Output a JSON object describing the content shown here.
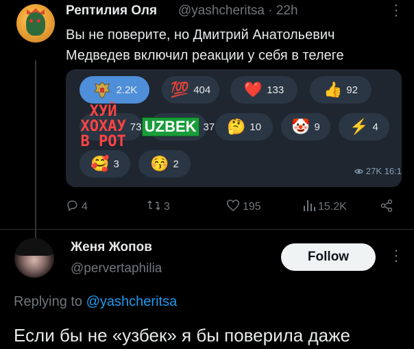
{
  "tweet": {
    "author_name": "Рептилия Оля",
    "handle": "@yashcheritsa",
    "separator": "·",
    "time": "22h",
    "text": "Вы не поверите, но Дмитрий Анатольевич Медведев включил реакции у себя в телеге",
    "more_icon": "more-vertical-icon"
  },
  "reactions_card": {
    "reactions": [
      {
        "icon": "coat-of-arms-emoji",
        "count": "2.2K",
        "active": true
      },
      {
        "icon": "hundred-emoji",
        "glyph": "💯",
        "count": "404"
      },
      {
        "icon": "heart-emoji",
        "glyph": "❤️",
        "count": "133"
      },
      {
        "icon": "thumbs-up-emoji",
        "glyph": "👍",
        "count": "92"
      },
      {
        "icon": "text-sticker-emoji",
        "sticker_text": "ХУЙ\nХОХАУ\nВ РОТ",
        "count": "73"
      },
      {
        "icon": "uzbek-sticker-emoji",
        "sticker_text": "UZBEK",
        "count": "37"
      },
      {
        "icon": "thinking-emoji",
        "glyph": "🤔",
        "count": "10"
      },
      {
        "icon": "clown-emoji",
        "glyph": "🤡",
        "count": "9"
      },
      {
        "icon": "lightning-emoji",
        "glyph": "⚡",
        "count": "4"
      },
      {
        "icon": "hearts-face-emoji",
        "glyph": "🥰",
        "count": "3"
      },
      {
        "icon": "kiss-face-emoji",
        "glyph": "😚",
        "count": "2"
      }
    ],
    "views": "27K",
    "time": "16:1"
  },
  "actions": {
    "replies": "4",
    "retweets": "3",
    "likes": "195",
    "views": "15.2K"
  },
  "reply": {
    "author_name": "Женя Жопов",
    "handle": "@pervertaphilia",
    "follow_label": "Follow",
    "replying_to_prefix": "Replying to",
    "replying_to_handle": "@yashcheritsa",
    "text": "Если бы не «узбек» я бы поверила даже"
  },
  "colors": {
    "background": "#000000",
    "primary_text": "#e7e9ea",
    "secondary_text": "#71767b",
    "link": "#1d9bf0",
    "card_bg": "#1f2630",
    "pill_bg": "#2b3644",
    "pill_active": "#4f8fd9"
  }
}
